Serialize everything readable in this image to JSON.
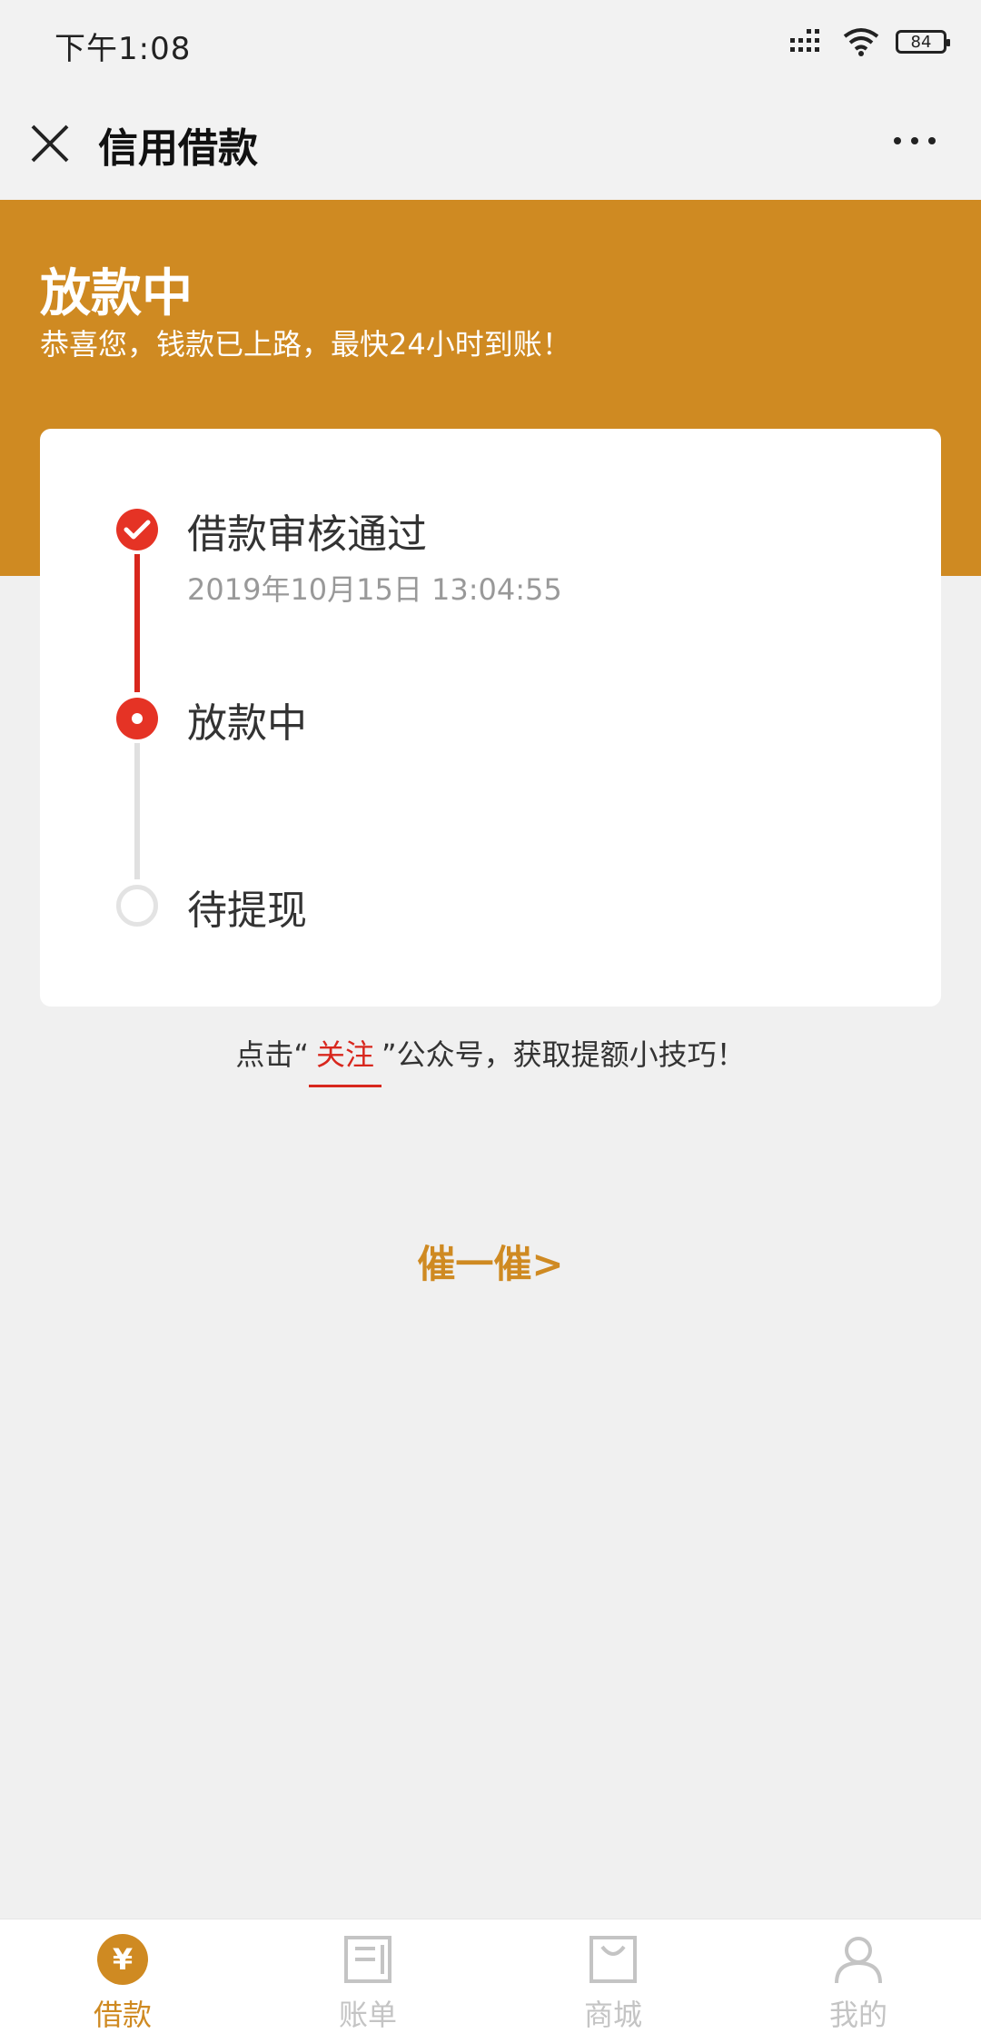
{
  "status_bar": {
    "time": "下午1:08",
    "battery": "84"
  },
  "nav": {
    "title": "信用借款",
    "close_icon": "close-icon",
    "more_icon": "more-icon"
  },
  "banner": {
    "title": "放款中",
    "subtitle": "恭喜您，钱款已上路，最快24小时到账！"
  },
  "steps": [
    {
      "label": "借款审核通过",
      "time": "2019年10月15日 13:04:55",
      "state": "done"
    },
    {
      "label": "放款中",
      "state": "active"
    },
    {
      "label": "待提现",
      "state": "pending"
    }
  ],
  "follow_hint": {
    "prefix": "点击“",
    "link": "关注",
    "suffix": "”公众号，获取提额小技巧！"
  },
  "urge_button": "催一催>",
  "tabs": [
    {
      "label": "借款",
      "icon": "yuan-icon",
      "active": true
    },
    {
      "label": "账单",
      "icon": "bill-icon",
      "active": false
    },
    {
      "label": "商城",
      "icon": "shop-bag-icon",
      "active": false
    },
    {
      "label": "我的",
      "icon": "profile-icon",
      "active": false
    }
  ],
  "colors": {
    "brand": "#cf8a22",
    "accent_red": "#e53325",
    "background": "#f0f0f0"
  }
}
